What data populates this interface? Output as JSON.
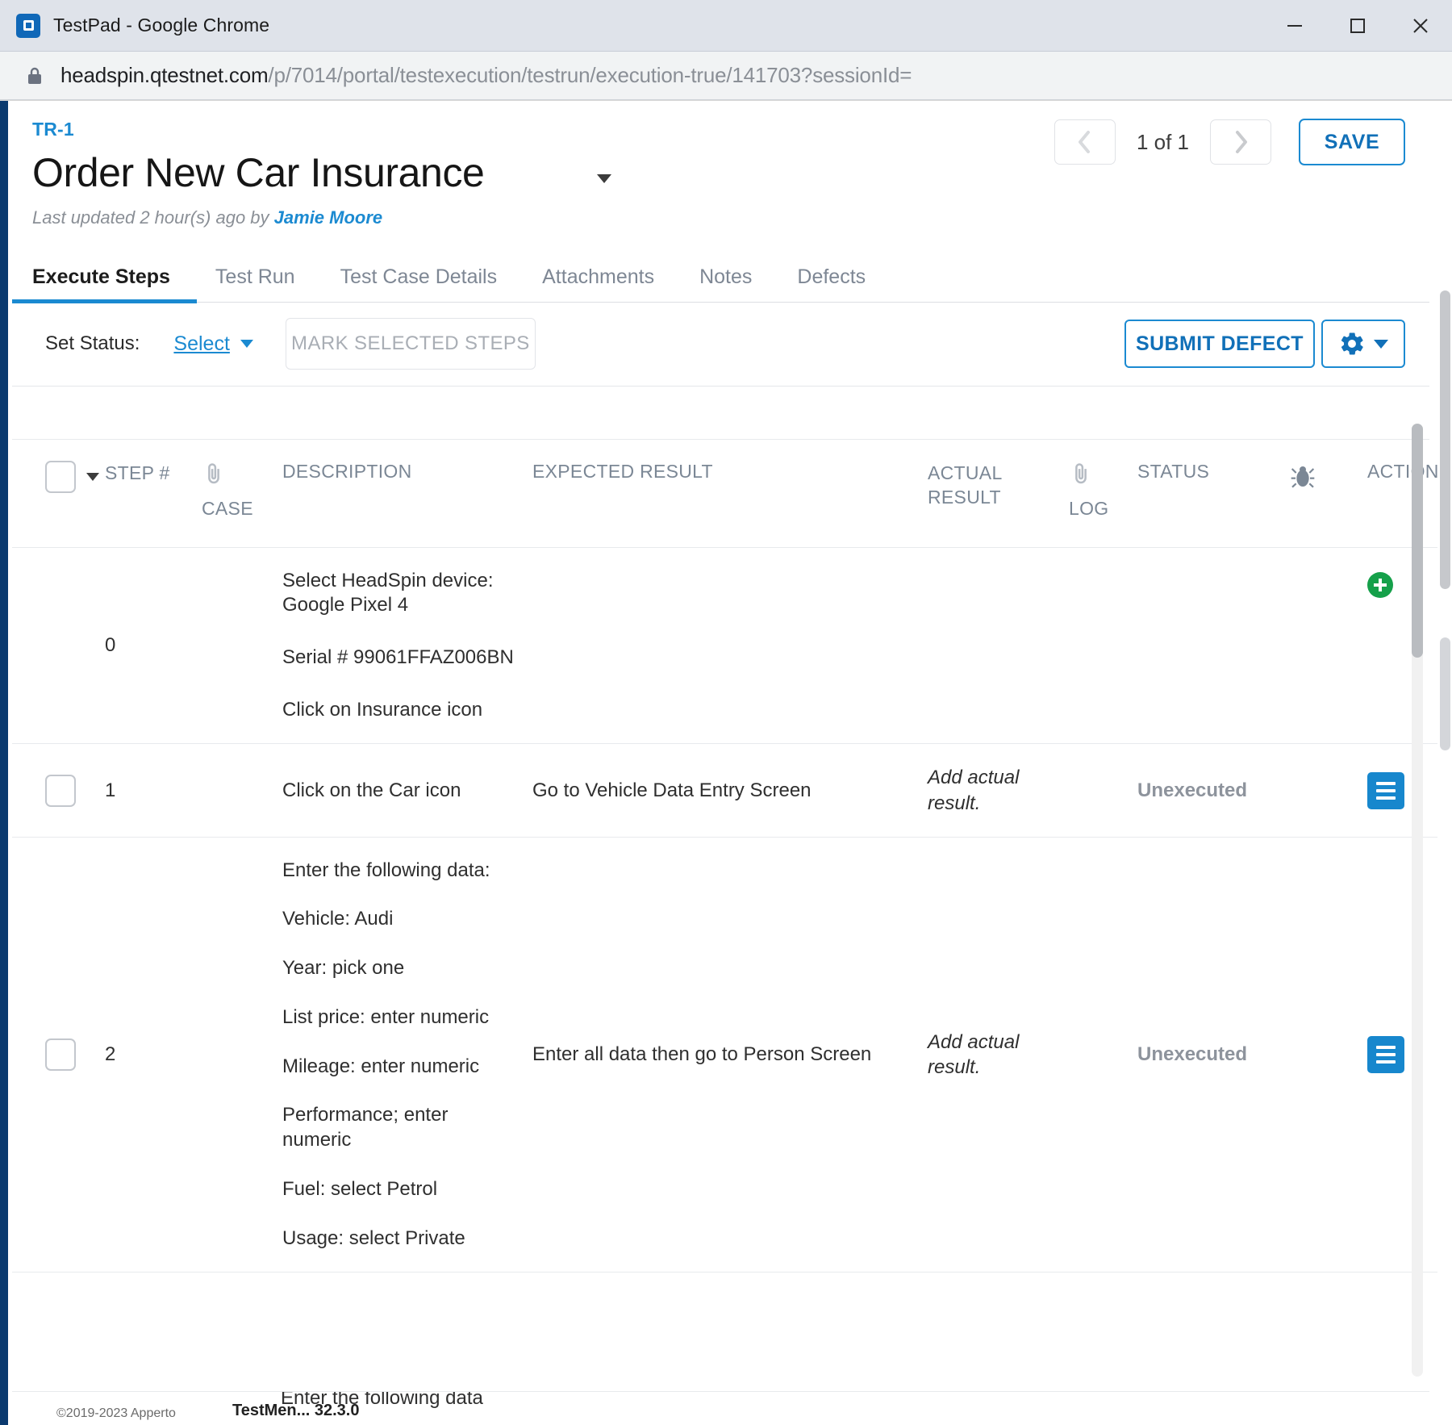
{
  "browser": {
    "window_title": "TestPad - Google Chrome",
    "app_icon": "testpad-icon",
    "minimize": "minimize-icon",
    "maximize": "maximize-icon",
    "close": "close-icon",
    "lock_icon": "lock-icon",
    "url_host": "headspin.qtestnet.com",
    "url_path": "/p/7014/portal/testexecution/testrun/execution-true/141703?sessionId="
  },
  "header": {
    "test_run_id": "TR-1",
    "title": "Order New Car Insurance",
    "title_caret": "chevron-down-icon",
    "last_updated_prefix": "Last updated 2 hour(s) ago by ",
    "last_updated_user": "Jamie Moore",
    "pager": {
      "prev": "chevron-left-icon",
      "position": "1 of 1",
      "next": "chevron-right-icon"
    },
    "save_label": "SAVE"
  },
  "tabs": [
    {
      "label": "Execute Steps",
      "active": true
    },
    {
      "label": "Test Run",
      "active": false
    },
    {
      "label": "Test Case Details",
      "active": false
    },
    {
      "label": "Attachments",
      "active": false
    },
    {
      "label": "Notes",
      "active": false
    },
    {
      "label": "Defects",
      "active": false
    }
  ],
  "toolbar": {
    "set_status_label": "Set Status:",
    "select_label": "Select",
    "select_caret": "caret-down-icon",
    "mark_selected_label": "MARK SELECTED STEPS",
    "submit_defect_label": "SUBMIT DEFECT",
    "gear_icon": "gear-icon",
    "gear_caret": "caret-down-icon"
  },
  "table": {
    "columns": {
      "select_all": "select-all-checkbox",
      "step": "STEP #",
      "case_icon": "paperclip-icon",
      "case": "CASE",
      "description": "DESCRIPTION",
      "expected_result": "EXPECTED RESULT",
      "actual_result": "ACTUAL RESULT",
      "log_icon": "paperclip-icon",
      "log": "LOG",
      "status": "STATUS",
      "defect_icon": "bug-icon",
      "action": "ACTION"
    },
    "rows": [
      {
        "has_checkbox": false,
        "step": "0",
        "description_lines": [
          "Select HeadSpin device: Google Pixel 4",
          "Serial # 99061FFAZ006BN",
          "Click on Insurance icon"
        ],
        "expected_result": "",
        "actual_result": "",
        "status": "",
        "action_icon": "add-circle-icon"
      },
      {
        "has_checkbox": true,
        "step": "1",
        "description_lines": [
          "Click on the Car icon"
        ],
        "expected_result": "Go to Vehicle Data Entry Screen",
        "actual_result": "Add actual result.",
        "status": "Unexecuted",
        "action_icon": "menu-lines-icon"
      },
      {
        "has_checkbox": true,
        "step": "2",
        "description_lines": [
          "Enter the following data:",
          "Vehicle: Audi",
          "Year: pick one",
          "List price: enter numeric",
          "Mileage: enter numeric",
          "Performance; enter numeric",
          "Fuel: select Petrol",
          "Usage: select Private"
        ],
        "expected_result": "Enter all data then go to Person Screen",
        "actual_result": "Add actual result.",
        "status": "Unexecuted",
        "action_icon": "menu-lines-icon"
      }
    ],
    "partial_row": {
      "description": "Enter the following data",
      "left_text": "©2019-2023 Apperto",
      "mid_text": "TestMen... 32.3.0"
    }
  },
  "colors": {
    "accent_blue": "#1b8ad1",
    "link_blue": "#1170b8",
    "action_blue": "#1787cd",
    "success_green": "#15a04a",
    "muted_gray": "#8a8f96"
  }
}
